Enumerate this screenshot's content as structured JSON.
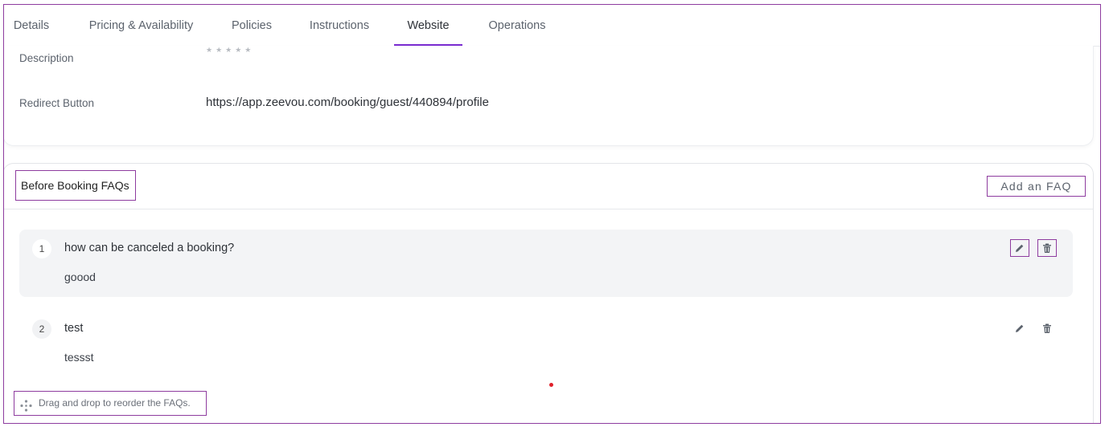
{
  "tabs": [
    {
      "label": "Details"
    },
    {
      "label": "Pricing & Availability"
    },
    {
      "label": "Policies"
    },
    {
      "label": "Instructions"
    },
    {
      "label": "Website",
      "active": true
    },
    {
      "label": "Operations"
    }
  ],
  "website": {
    "description_label": "Description",
    "redirect_label": "Redirect Button",
    "redirect_value": "https://app.zeevou.com/booking/guest/440894/profile"
  },
  "faq": {
    "title": "Before Booking FAQs",
    "add_label": "Add an FAQ",
    "items": [
      {
        "number": "1",
        "question": "how can be canceled a booking?",
        "answer": "goood"
      },
      {
        "number": "2",
        "question": "test",
        "answer": "tessst"
      }
    ],
    "drag_hint": "Drag and drop to reorder the FAQs."
  },
  "icons": {
    "edit": "pencil-icon",
    "delete": "trash-icon",
    "drag": "move-icon"
  },
  "colors": {
    "accent": "#7a2bd0",
    "outline": "#8e3c9f",
    "row_highlight": "#f3f4f6"
  }
}
